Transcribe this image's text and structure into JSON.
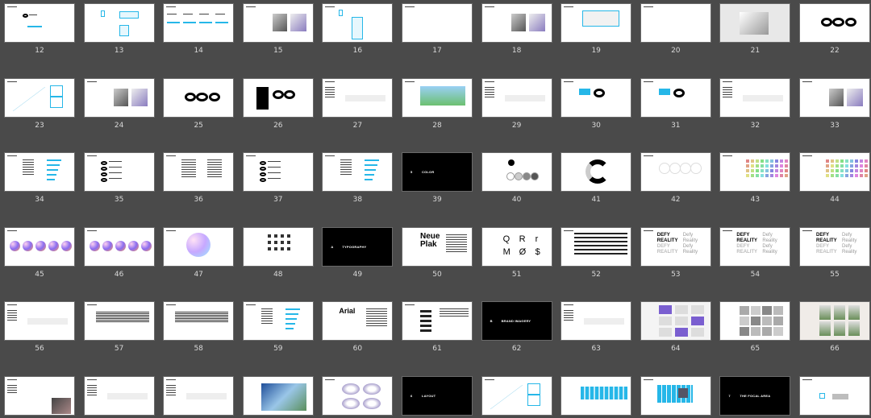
{
  "background": "#4a4a4a",
  "accent": "#26b7e8",
  "slides": [
    {
      "n": "12",
      "kind": "logo"
    },
    {
      "n": "13",
      "kind": "logo-grid"
    },
    {
      "n": "14",
      "kind": "logo-row"
    },
    {
      "n": "15",
      "kind": "photos"
    },
    {
      "n": "16",
      "kind": "logo-boxes"
    },
    {
      "n": "17",
      "kind": "blank"
    },
    {
      "n": "18",
      "kind": "photos"
    },
    {
      "n": "19",
      "kind": "frame"
    },
    {
      "n": "20",
      "kind": "blank"
    },
    {
      "n": "21",
      "kind": "product"
    },
    {
      "n": "22",
      "kind": "rings"
    },
    {
      "n": "23",
      "kind": "diagonal"
    },
    {
      "n": "24",
      "kind": "photos"
    },
    {
      "n": "25",
      "kind": "rings"
    },
    {
      "n": "26",
      "kind": "rings-photo"
    },
    {
      "n": "27",
      "kind": "text"
    },
    {
      "n": "28",
      "kind": "landscape"
    },
    {
      "n": "29",
      "kind": "text"
    },
    {
      "n": "30",
      "kind": "blue-rings"
    },
    {
      "n": "31",
      "kind": "blue-rings"
    },
    {
      "n": "32",
      "kind": "text"
    },
    {
      "n": "33",
      "kind": "photos"
    },
    {
      "n": "34",
      "kind": "blue-list"
    },
    {
      "n": "35",
      "kind": "logo-words"
    },
    {
      "n": "36",
      "kind": "lists"
    },
    {
      "n": "37",
      "kind": "logo-words"
    },
    {
      "n": "38",
      "kind": "blue-list"
    },
    {
      "n": "39",
      "kind": "section",
      "sec": "5",
      "title": "COLOR"
    },
    {
      "n": "40",
      "kind": "swatches"
    },
    {
      "n": "41",
      "kind": "donut"
    },
    {
      "n": "42",
      "kind": "circles"
    },
    {
      "n": "43",
      "kind": "palette"
    },
    {
      "n": "44",
      "kind": "palette"
    },
    {
      "n": "45",
      "kind": "gradients"
    },
    {
      "n": "46",
      "kind": "gradients"
    },
    {
      "n": "47",
      "kind": "gradient-big"
    },
    {
      "n": "48",
      "kind": "icons"
    },
    {
      "n": "49",
      "kind": "section",
      "sec": "A",
      "title": "TYPOGRAPHY"
    },
    {
      "n": "50",
      "kind": "type",
      "big": [
        "Neue",
        "Plak"
      ]
    },
    {
      "n": "51",
      "kind": "glyphs",
      "glyphs": [
        "Q",
        "R",
        "r",
        "M",
        "Ø",
        "$"
      ]
    },
    {
      "n": "52",
      "kind": "alphabet"
    },
    {
      "n": "53",
      "kind": "defy",
      "big": [
        "DEFY",
        "REALITY",
        "DEFY",
        "REALITY"
      ],
      "light": [
        "Defy",
        "Reality",
        "Defy",
        "Reality"
      ]
    },
    {
      "n": "54",
      "kind": "defy",
      "big": [
        "DEFY",
        "REALITY",
        "DEFY",
        "REALITY"
      ],
      "light": [
        "Defy",
        "Reality",
        "Defy",
        "Reality"
      ]
    },
    {
      "n": "55",
      "kind": "defy",
      "big": [
        "DEFY",
        "REALITY",
        "DEFY",
        "REALITY"
      ],
      "light": [
        "Defy",
        "Reality",
        "Defy",
        "Reality"
      ]
    },
    {
      "n": "56",
      "kind": "text"
    },
    {
      "n": "57",
      "kind": "table"
    },
    {
      "n": "58",
      "kind": "table"
    },
    {
      "n": "59",
      "kind": "blue-list"
    },
    {
      "n": "60",
      "kind": "arial",
      "big": [
        "Arial"
      ]
    },
    {
      "n": "61",
      "kind": "type-sizes"
    },
    {
      "n": "62",
      "kind": "section",
      "sec": "B",
      "title": "BRAND IMAGERY"
    },
    {
      "n": "63",
      "kind": "text"
    },
    {
      "n": "64",
      "kind": "products"
    },
    {
      "n": "65",
      "kind": "grey-photos"
    },
    {
      "n": "66",
      "kind": "people"
    },
    {
      "n": "",
      "kind": "text-photo"
    },
    {
      "n": "",
      "kind": "text"
    },
    {
      "n": "",
      "kind": "text"
    },
    {
      "n": "",
      "kind": "landscapes"
    },
    {
      "n": "",
      "kind": "headsets"
    },
    {
      "n": "",
      "kind": "section",
      "sec": "6",
      "title": "LAYOUT"
    },
    {
      "n": "",
      "kind": "diagonal"
    },
    {
      "n": "",
      "kind": "stripes"
    },
    {
      "n": "",
      "kind": "stripes-photo"
    },
    {
      "n": "",
      "kind": "section",
      "sec": "7",
      "title": "THE FOCAL AREA"
    },
    {
      "n": "",
      "kind": "frame-small"
    }
  ]
}
